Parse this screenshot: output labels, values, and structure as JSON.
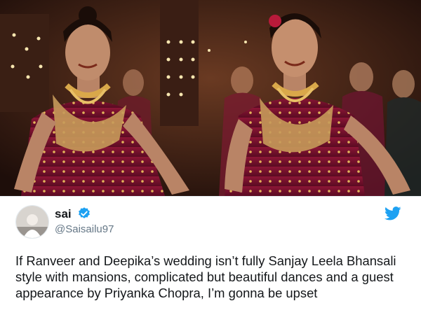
{
  "tweet": {
    "display_name": "sai",
    "handle": "@Saisailu97",
    "text": "If Ranveer and Deepika’s wedding isn’t fully Sanjay Leela Bhansali style with mansions, complicated but beautiful dances and a guest appearance by Priyanka Chopra, I’m gonna be upset",
    "verified": true
  },
  "icons": {
    "verified": "verified-badge-icon",
    "brand": "twitter-bird-icon"
  },
  "colors": {
    "twitter_blue": "#1da1f2",
    "saree": "#7a1030",
    "text": "#14171a",
    "handle": "#657786"
  }
}
